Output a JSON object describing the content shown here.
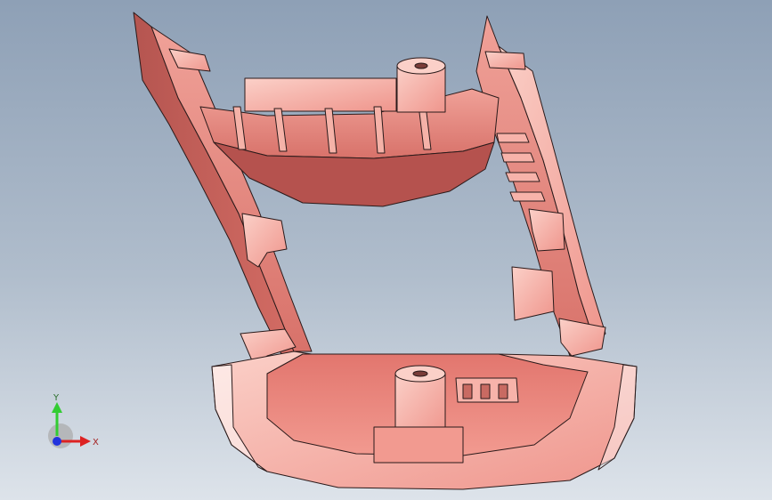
{
  "viewport": {
    "background_top": "#8ea0b6",
    "background_bottom": "#dde3ea"
  },
  "model": {
    "fill_color": "#e8817a",
    "light_color": "#f7b3aa",
    "dark_color": "#b85850",
    "edge_color": "#2a1a1a"
  },
  "triad": {
    "y_label": "Y",
    "x_label": "X",
    "y_color": "#33cc33",
    "x_color": "#dd2222",
    "z_color": "#2233dd"
  }
}
